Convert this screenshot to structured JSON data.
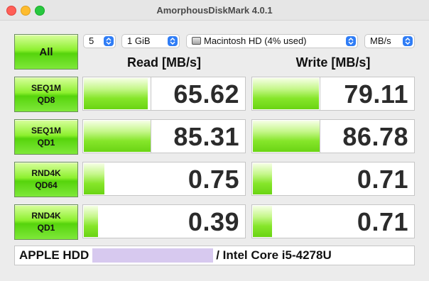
{
  "window": {
    "title": "AmorphousDiskMark 4.0.1"
  },
  "controls": {
    "all_label": "All",
    "count": "5",
    "size": "1 GiB",
    "disk": "Macintosh HD (4% used)",
    "unit": "MB/s"
  },
  "headers": {
    "read": "Read [MB/s]",
    "write": "Write [MB/s]"
  },
  "tests": [
    {
      "line1": "SEQ1M",
      "line2": "QD8",
      "read": "65.62",
      "write": "79.11",
      "read_fill": 0.4,
      "write_fill": 0.41
    },
    {
      "line1": "SEQ1M",
      "line2": "QD1",
      "read": "85.31",
      "write": "86.78",
      "read_fill": 0.42,
      "write_fill": 0.42
    },
    {
      "line1": "RND4K",
      "line2": "QD64",
      "read": "0.75",
      "write": "0.71",
      "read_fill": 0.13,
      "write_fill": 0.12
    },
    {
      "line1": "RND4K",
      "line2": "QD1",
      "read": "0.39",
      "write": "0.71",
      "read_fill": 0.09,
      "write_fill": 0.12
    }
  ],
  "footer": {
    "left": "APPLE HDD",
    "right": "/ Intel Core i5-4278U"
  },
  "colors": {
    "accent": "#2f7df6",
    "bar_green": "#86e62a",
    "redaction": "#d7c9ef"
  }
}
